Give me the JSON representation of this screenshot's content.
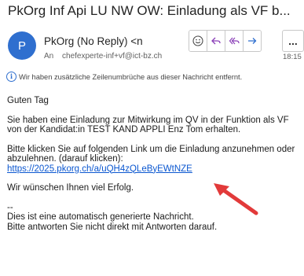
{
  "email": {
    "subject": "PkOrg Inf Api LU NW OW: Einladung als VF b...",
    "avatar_initial": "P",
    "sender": "PkOrg (No Reply) <n",
    "to_label": "An",
    "recipient": "chefexperte-inf+vf@ict-bz.ch",
    "time": "18:15",
    "info_notice": "Wir haben zusätzliche Zeilenumbrüche aus dieser Nachricht entfernt."
  },
  "actions": {
    "icons": [
      "emoji-reaction-icon",
      "reply-icon",
      "reply-all-icon",
      "forward-icon"
    ],
    "more": "..."
  },
  "body": {
    "greeting": "Guten Tag",
    "invite": "Sie haben eine Einladung zur Mitwirkung im QV in der Funktion als VF von der Kandidat:in TEST KAND APPLI Enz Tom erhalten.",
    "instruction": "Bitte klicken Sie auf folgenden Link um die Einladung anzunehmen oder abzulehnen. (darauf klicken):",
    "link": "https://2025.pkorg.ch/a/uQH4zQLeByEWtNZE",
    "wish": "Wir wünschen Ihnen viel Erfolg.",
    "separator": "--",
    "auto_note": "Dies ist eine automatisch generierte Nachricht.",
    "no_reply": "Bitte antworten Sie nicht direkt mit Antworten darauf."
  },
  "colors": {
    "accent": "#2f6fcf",
    "link": "#0b57d0",
    "annotation_arrow": "#e23a3a"
  }
}
